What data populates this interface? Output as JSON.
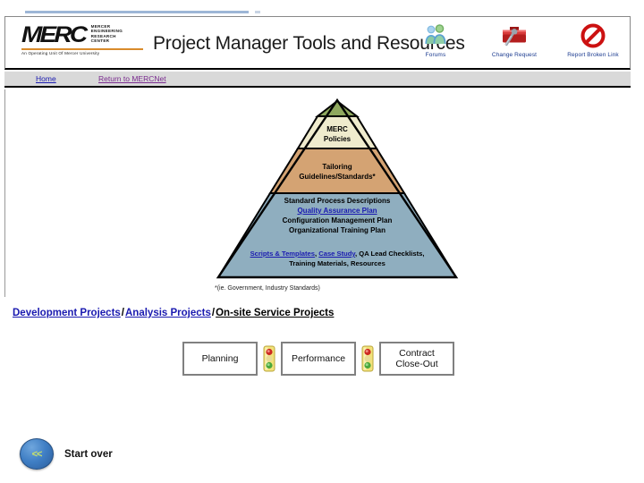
{
  "header": {
    "logo": {
      "mark": "MERC",
      "expansion": "MERCER\nENGINEERING\nRESEARCH\nCENTER",
      "expansion_lines": [
        "MERCER",
        "ENGINEERING",
        "RESEARCH",
        "CENTER"
      ],
      "tagline": "An Operating Unit Of Mercer University",
      "rule_color": "#d98b2b"
    },
    "title": "Project Manager Tools and Resources",
    "icons": [
      {
        "name": "forums-icon",
        "label": "Forums"
      },
      {
        "name": "change-request-icon",
        "label": "Change Request"
      },
      {
        "name": "report-broken-link-icon",
        "label": "Report Broken Link"
      }
    ]
  },
  "nav": {
    "home": "Home",
    "mercnet": "Return to MERCNet",
    "home_color": "#1a1ab0",
    "mercnet_color": "#7a2b8f",
    "background": "#d9d9d9"
  },
  "pyramid": {
    "tiers": [
      {
        "id": "merc-policies",
        "color": "#8fa85e",
        "lines": [
          "MERC",
          "Policies"
        ]
      },
      {
        "id": "tailoring",
        "color": "#efebcd",
        "lines": [
          "Tailoring",
          "Guidelines/Standards*"
        ]
      },
      {
        "id": "standard-process",
        "color": "#d4a373",
        "lines": [
          "Standard Process Descriptions",
          "Quality Assurance Plan",
          "Configuration Management Plan",
          "Organizational Training Plan"
        ],
        "link_line_index": 1,
        "link_text": "Quality Assurance Plan"
      },
      {
        "id": "resources",
        "color": "#8faebf",
        "line1_links": [
          "Scripts & Templates",
          "Case Study"
        ],
        "line1_rest": "QA Lead Checklists,",
        "line2": "Training Materials,  Resources"
      }
    ],
    "footnote": "*(ie. Government, Industry Standards)"
  },
  "breadcrumb": {
    "items": [
      {
        "label": "Development Projects",
        "current": false
      },
      {
        "label": "Analysis Projects",
        "current": false
      },
      {
        "label": "On-site Service Projects",
        "current": true
      }
    ],
    "separator": "/"
  },
  "process_flow": {
    "steps": [
      {
        "label": "Planning"
      },
      {
        "label": "Performance"
      },
      {
        "label": "Contract\nClose-Out",
        "line1": "Contract",
        "line2": "Close-Out"
      }
    ],
    "separator_icon": "traffic-light-icon"
  },
  "footer": {
    "back_glyph": "<<",
    "start_over_label": "Start over"
  }
}
